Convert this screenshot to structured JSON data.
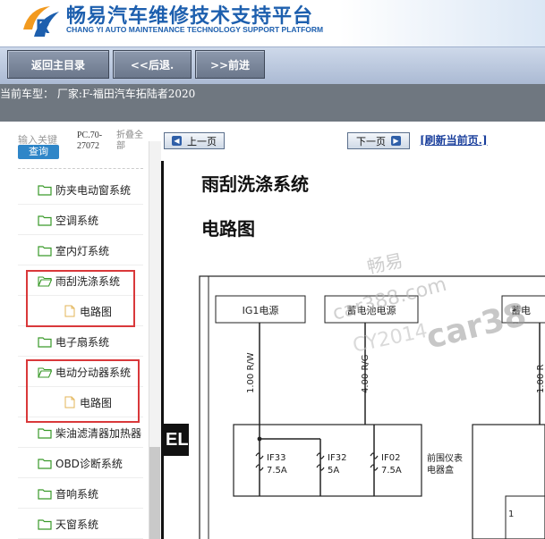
{
  "header": {
    "title": "畅易汽车维修技术支持平台",
    "subtitle": "CHANG YI AUTO MAINTENANCE TECHNOLOGY SUPPORT PLATFORM"
  },
  "nav": {
    "home_label": "返回主目录",
    "back_label": "<<后退.",
    "forward_label": ">>前进"
  },
  "vehicle": {
    "text": "当前车型：  厂家:F-福田汽车拓陆者2020"
  },
  "sidebar": {
    "search_placeholder": "输入关键",
    "search_button": "查询",
    "code": "PC.70-27072",
    "collapse": "折叠全部",
    "items": [
      {
        "label": "防夹电动窗系统",
        "type": "folder"
      },
      {
        "label": "空调系统",
        "type": "folder"
      },
      {
        "label": "室内灯系统",
        "type": "folder"
      },
      {
        "label": "雨刮洗涤系统",
        "type": "folder",
        "open": true
      },
      {
        "label": "电路图",
        "type": "file"
      },
      {
        "label": "电子扇系统",
        "type": "folder"
      },
      {
        "label": "电动分动器系统",
        "type": "folder",
        "open": true
      },
      {
        "label": "电路图",
        "type": "file"
      },
      {
        "label": "柴油滤清器加热器",
        "type": "folder"
      },
      {
        "label": "OBD诊断系统",
        "type": "folder"
      },
      {
        "label": "音响系统",
        "type": "folder"
      },
      {
        "label": "天窗系统",
        "type": "folder"
      }
    ]
  },
  "content": {
    "prev_page": "上一页",
    "next_page": "下一页",
    "refresh": "[刷新当前页.]",
    "doc_title": "雨刮洗涤系统",
    "doc_subtitle": "电路图",
    "edge_label": "EL",
    "diagram": {
      "box_ig1": "IG1电源",
      "box_battery": "蓄电池电源",
      "box_battery_cut": "蓄电",
      "wire_1": "1.00 R/W",
      "wire_2": "4.00 R/G",
      "wire_3": "1.00 R",
      "fuse_1_name": "IF33",
      "fuse_1_rating": "7.5A",
      "fuse_2_name": "IF32",
      "fuse_2_rating": "5A",
      "fuse_3_name": "IF02",
      "fuse_3_rating": "7.5A",
      "fuse_box_label_1": "前围仪表",
      "fuse_box_label_2": "电器盒",
      "pin_1": "1"
    },
    "watermark": {
      "line1": "畅易",
      "line2": "car388.com",
      "line3": "CY2014",
      "logo_text": "car38"
    }
  },
  "colors": {
    "brand_blue": "#1d5fae",
    "nav_bar": "#aab9d3",
    "highlight_red": "#d9383a",
    "search_blue": "#2f86c8",
    "folder_green": "#3a9a2a"
  }
}
